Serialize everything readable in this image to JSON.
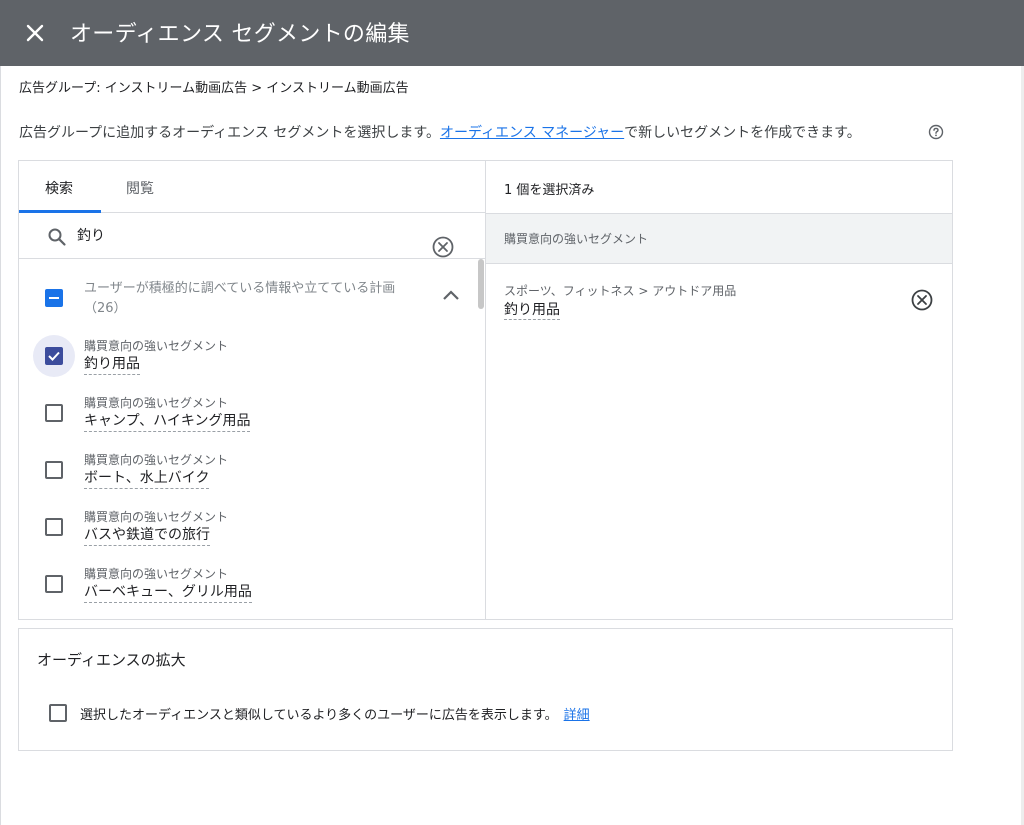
{
  "header": {
    "title": "オーディエンス セグメントの編集"
  },
  "breadcrumb": "広告グループ: インストリーム動画広告 > インストリーム動画広告",
  "description": {
    "text_before": "広告グループに追加するオーディエンス セグメントを選択します。",
    "link": "オーディエンス マネージャー",
    "text_after": "で新しいセグメントを作成できます。"
  },
  "tabs": [
    "検索",
    "閲覧"
  ],
  "search": {
    "value": "釣り"
  },
  "group": {
    "label": "ユーザーが積極的に調べている情報や立てている計画",
    "count": "（26）"
  },
  "results": [
    {
      "category": "購買意向の強いセグメント",
      "name": "釣り用品",
      "checked": true
    },
    {
      "category": "購買意向の強いセグメント",
      "name": "キャンプ、ハイキング用品",
      "checked": false
    },
    {
      "category": "購買意向の強いセグメント",
      "name": "ボート、水上バイク",
      "checked": false
    },
    {
      "category": "購買意向の強いセグメント",
      "name": "バスや鉄道での旅行",
      "checked": false
    },
    {
      "category": "購買意向の強いセグメント",
      "name": "バーベキュー、グリル用品",
      "checked": false
    }
  ],
  "selected": {
    "count_label": "1 個を選択済み",
    "section_label": "購買意向の強いセグメント",
    "item_path": "スポーツ、フィットネス > アウトドア用品",
    "item_name": "釣り用品"
  },
  "expansion": {
    "title": "オーディエンスの拡大",
    "checkbox_label": "選択したオーディエンスと類似しているより多くのユーザーに広告を表示します。",
    "link": "詳細"
  },
  "colors": {
    "header_bg": "#5f6368",
    "accent": "#1a73e8",
    "checked": "#3c4c9c"
  }
}
